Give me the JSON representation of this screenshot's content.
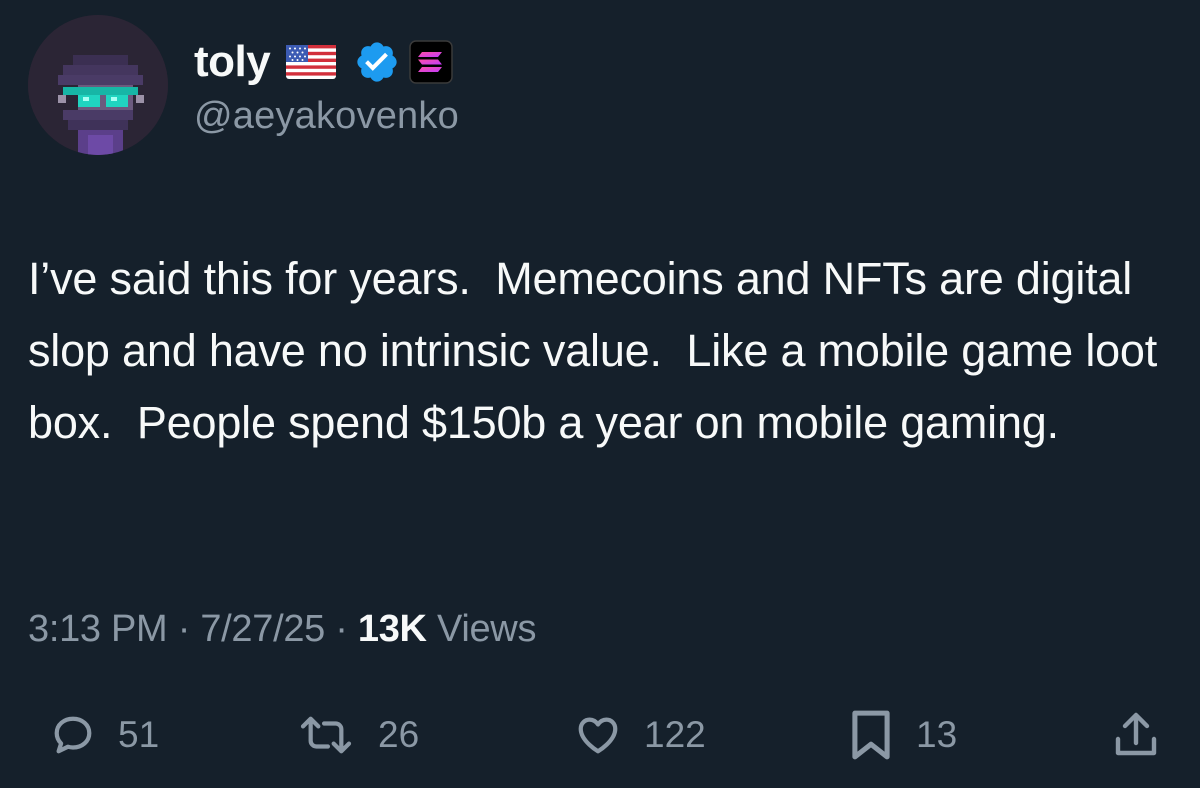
{
  "author": {
    "display_name": "toly",
    "handle": "@aeyakovenko",
    "avatar": "pixel-avatar-with-sunglasses",
    "badges": [
      "us-flag-icon",
      "verified-icon",
      "solana-affiliate-icon"
    ],
    "verified_color": "#1d9bf0"
  },
  "tweet": {
    "text": "I’ve said this for years.  Memecoins and NFTs are digital slop and have no intrinsic value.  Like a mobile game loot box.  People spend $150b a year on mobile gaming.",
    "time": "3:13 PM",
    "date": "7/27/25",
    "views_count": "13K",
    "views_label": "Views",
    "separator": "·"
  },
  "actions": {
    "replies": "51",
    "reposts": "26",
    "likes": "122",
    "bookmarks": "13"
  },
  "colors": {
    "background": "#15202b",
    "text": "#f7f9f9",
    "muted": "#8b98a5"
  }
}
